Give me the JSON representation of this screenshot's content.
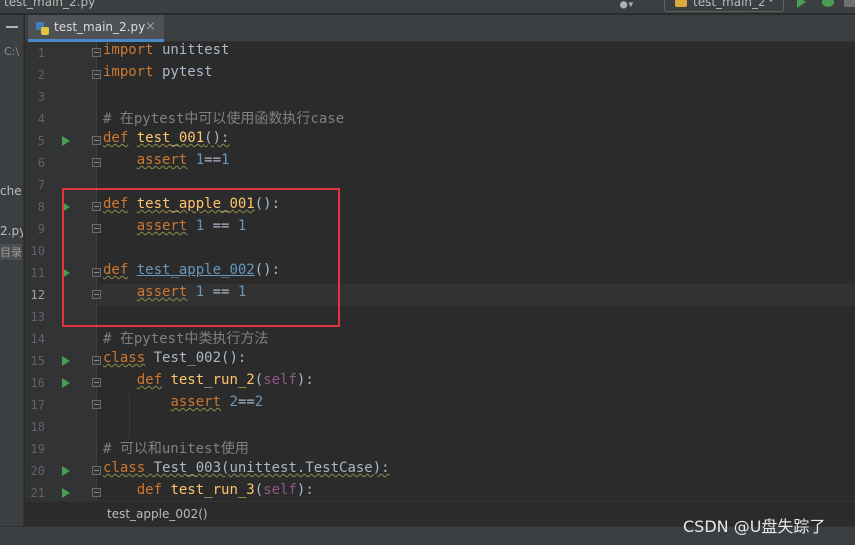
{
  "window": {
    "title_file": "test_main_2.py",
    "run_config": "test_main_2"
  },
  "colors": {
    "keyword": "#cc7832",
    "function": "#ffc66d",
    "number": "#6897bb",
    "comment": "#808080",
    "self": "#94558d",
    "text": "#a9b7c6",
    "highlight_box": "#e0343f",
    "run_green": "#499c54"
  },
  "sidebar": {
    "path_fragment": "C:\\",
    "item_1": "che",
    "item_2": "2.py",
    "item_3": "目录"
  },
  "tab": {
    "label": "test_main_2.py",
    "close": "×"
  },
  "editor": {
    "line_numbers": [
      "1",
      "2",
      "3",
      "4",
      "5",
      "6",
      "7",
      "8",
      "9",
      "10",
      "11",
      "12",
      "13",
      "14",
      "15",
      "16",
      "17",
      "18",
      "19",
      "20",
      "21"
    ],
    "current_line": 12,
    "lines": {
      "l1": {
        "kw": "import",
        "rest": " unittest"
      },
      "l2": {
        "kw": "import",
        "rest": " pytest"
      },
      "l4": {
        "comment": "# 在pytest中可以使用函数执行case"
      },
      "l5": {
        "kw": "def",
        "name": "test_001",
        "rest": "():"
      },
      "l6": {
        "kw": "assert",
        "n1": "1",
        "op": "==",
        "n2": "1"
      },
      "l8": {
        "kw": "def",
        "name": "test_apple_001",
        "rest": "():"
      },
      "l9": {
        "kw": "assert",
        "n1": "1",
        "op": " == ",
        "n2": "1"
      },
      "l11": {
        "kw": "def",
        "name": "test_apple_002",
        "rest": "():"
      },
      "l12": {
        "kw": "assert",
        "n1": "1",
        "op": " == ",
        "n2": "1"
      },
      "l14": {
        "comment": "# 在pytest中类执行方法"
      },
      "l15": {
        "kw": "class",
        "rest": " Test_002():"
      },
      "l16": {
        "kw": "def",
        "name": "test_run_2",
        "open": "(",
        "self": "self",
        "close": "):"
      },
      "l17": {
        "kw": "assert",
        "n1": "2",
        "op": "==",
        "n2": "2"
      },
      "l19": {
        "comment": "# 可以和unitest使用"
      },
      "l20": {
        "kw": "class",
        "rest": " Test_003(unittest.TestCase):"
      },
      "l21": {
        "kw": "def",
        "name": "test_run_3",
        "open": "(",
        "self": "self",
        "close": "):"
      }
    }
  },
  "breadcrumb": {
    "text": "test_apple_002()"
  },
  "watermark": "CSDN @U盘失踪了"
}
